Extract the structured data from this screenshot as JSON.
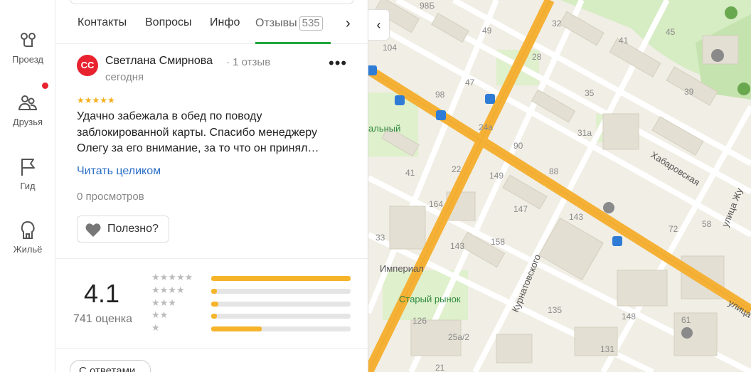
{
  "rail": {
    "items": [
      {
        "label": "Проезд",
        "icon": "route-icon"
      },
      {
        "label": "Друзья",
        "icon": "friends-icon"
      },
      {
        "label": "Гид",
        "icon": "flag-icon"
      },
      {
        "label": "Жильё",
        "icon": "house-icon"
      }
    ]
  },
  "tabs": {
    "items": [
      "Контакты",
      "Вопросы",
      "Инфо"
    ],
    "active_label": "Отзывы",
    "active_count": "535"
  },
  "review": {
    "avatar_initials": "СС",
    "author": "Светлана Смирнова",
    "author_reviews": "· 1 отзыв",
    "date": "сегодня",
    "stars": "★★★★★",
    "text": "Удачно забежала в обед по поводу заблокированной карты. Спасибо менеджеру Олегу за его внимание, за то что он принял…",
    "read_more": "Читать целиком",
    "views": "0 просмотров",
    "useful_label": "Полезно?"
  },
  "rating": {
    "value": "4.1",
    "count": "741 оценка",
    "distribution": [
      {
        "stars": "★★★★★",
        "fraction": 1.0
      },
      {
        "stars": "★★★★",
        "fraction": 0.04
      },
      {
        "stars": "★★★",
        "fraction": 0.05
      },
      {
        "stars": "★★",
        "fraction": 0.04
      },
      {
        "stars": "★",
        "fraction": 0.36
      }
    ]
  },
  "filters": {
    "with_answers": "С ответами"
  },
  "map": {
    "streets": [
      "Хабаровская",
      "Курнатовского",
      "улица Жу",
      "улица"
    ],
    "places": [
      "Старый рынок",
      "Империал",
      "альный"
    ],
    "house_numbers": [
      "98Б",
      "49",
      "32",
      "41",
      "45",
      "104",
      "28",
      "47",
      "98",
      "35",
      "39",
      "24а",
      "31а",
      "90",
      "22",
      "41",
      "88",
      "149",
      "147",
      "164",
      "143",
      "72",
      "58",
      "158",
      "33",
      "143",
      "135",
      "126",
      "148",
      "61",
      "131",
      "25а/2",
      "21"
    ]
  },
  "colors": {
    "accent_green": "#1fa73a",
    "link_blue": "#2a6ec5",
    "star_gold": "#f6ad1a",
    "notif_red": "#e8222e",
    "road_orange": "#f5b136"
  }
}
